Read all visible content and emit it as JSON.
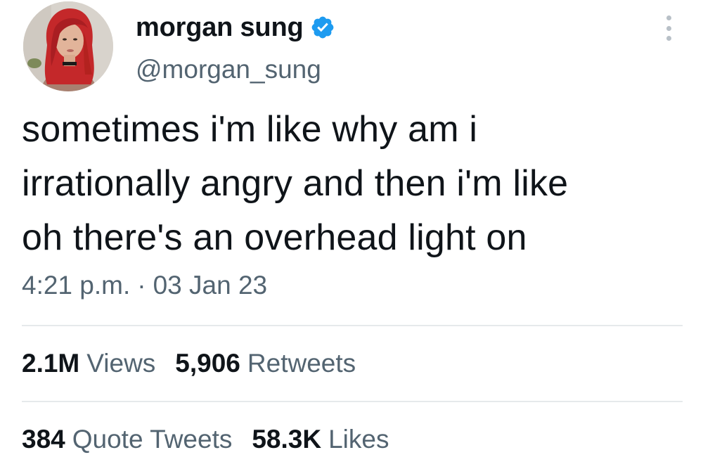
{
  "author": {
    "display_name": "morgan sung",
    "handle": "@morgan_sung",
    "verified": true,
    "avatar_icon": "profile-photo"
  },
  "tweet": {
    "text_lines": [
      "sometimes i'm like why am i",
      "irrationally angry and then i'm like",
      "oh there's an overhead light on"
    ],
    "time": "4:21 p.m.",
    "separator": "·",
    "date": "03 Jan 23"
  },
  "stats": {
    "views": {
      "value": "2.1M",
      "label": "Views"
    },
    "retweets": {
      "value": "5,906",
      "label": "Retweets"
    },
    "quote_tweets": {
      "value": "384",
      "label": "Quote Tweets"
    },
    "likes": {
      "value": "58.3K",
      "label": "Likes"
    }
  },
  "colors": {
    "text_primary": "#0f1419",
    "text_secondary": "#536471",
    "verified_blue": "#1d9bf0",
    "divider": "#e6e9eb"
  },
  "icons": {
    "verified": "verified-badge-icon",
    "more": "more-options-icon"
  }
}
